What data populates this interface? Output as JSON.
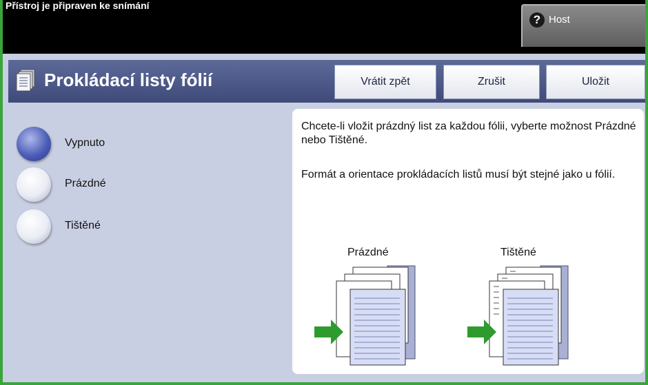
{
  "status": {
    "message": "Přístroj je připraven ke snímání",
    "host_label": "Host",
    "help_glyph": "?"
  },
  "header": {
    "title": "Prokládací listy fólií",
    "undo_label": "Vrátit zpět",
    "cancel_label": "Zrušit",
    "save_label": "Uložit"
  },
  "options": [
    {
      "label": "Vypnuto",
      "selected": true
    },
    {
      "label": "Prázdné",
      "selected": false
    },
    {
      "label": "Tištěné",
      "selected": false
    }
  ],
  "info": {
    "text1": "Chcete-li vložit prázdný list za každou fólii, vyberte možnost Prázdné nebo Tištěné.",
    "text2": "Formát a orientace prokládacích listů musí být stejné jako u fólií.",
    "illus_blank_label": "Prázdné",
    "illus_printed_label": "Tištěné"
  },
  "colors": {
    "frame": "#3aa53a",
    "title_bar": "#4b5786",
    "background": "#c9cfe2",
    "arrow": "#2e9b2e"
  }
}
